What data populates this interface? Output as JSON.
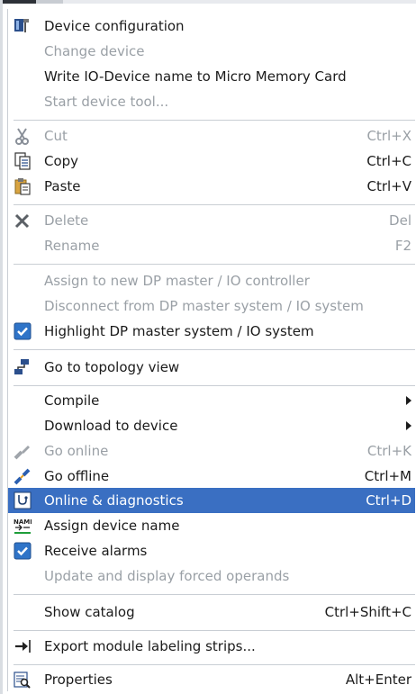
{
  "menu": {
    "device_configuration": "Device configuration",
    "change_device": "Change device",
    "write_io_device_name": "Write IO-Device name to Micro Memory Card",
    "start_device_tool": "Start device tool...",
    "cut": {
      "label": "Cut",
      "shortcut": "Ctrl+X"
    },
    "copy": {
      "label": "Copy",
      "shortcut": "Ctrl+C"
    },
    "paste": {
      "label": "Paste",
      "shortcut": "Ctrl+V"
    },
    "delete": {
      "label": "Delete",
      "shortcut": "Del"
    },
    "rename": {
      "label": "Rename",
      "shortcut": "F2"
    },
    "assign_master": "Assign to new DP master / IO controller",
    "disconnect_master": "Disconnect from DP master system / IO system",
    "highlight_master": "Highlight DP master system / IO system",
    "topology_view": "Go to topology view",
    "compile": "Compile",
    "download": "Download to device",
    "go_online": {
      "label": "Go online",
      "shortcut": "Ctrl+K"
    },
    "go_offline": {
      "label": "Go offline",
      "shortcut": "Ctrl+M"
    },
    "online_diag": {
      "label": "Online & diagnostics",
      "shortcut": "Ctrl+D"
    },
    "assign_device_name": "Assign device name",
    "receive_alarms": "Receive alarms",
    "update_forced": "Update and display forced operands",
    "show_catalog": {
      "label": "Show catalog",
      "shortcut": "Ctrl+Shift+C"
    },
    "export_labeling": "Export module labeling strips...",
    "properties": {
      "label": "Properties",
      "shortcut": "Alt+Enter"
    }
  },
  "icons": {
    "name_badge_top": "NAME",
    "name_badge_bottom": "⁀",
    "accent": "#3a6fc2"
  }
}
